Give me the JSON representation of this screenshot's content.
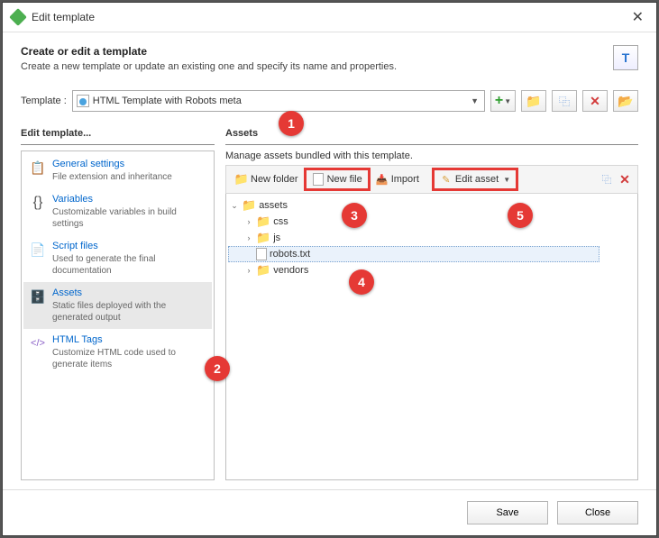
{
  "window": {
    "title": "Edit template"
  },
  "header": {
    "title": "Create or edit a template",
    "subtitle": "Create a new template or update an existing one and specify its name and properties.",
    "icon_letter": "T"
  },
  "template": {
    "label": "Template :",
    "value": "HTML Template with Robots meta"
  },
  "left_section": {
    "title": "Edit template..."
  },
  "nav": {
    "items": [
      {
        "title": "General settings",
        "sub": "File extension and inheritance"
      },
      {
        "title": "Variables",
        "sub": "Customizable variables in build settings"
      },
      {
        "title": "Script files",
        "sub": "Used to generate the final documentation"
      },
      {
        "title": "Assets",
        "sub": "Static files deployed with the generated output"
      },
      {
        "title": "HTML Tags",
        "sub": "Customize HTML code used to generate items"
      }
    ]
  },
  "right_section": {
    "title": "Assets",
    "subtitle": "Manage assets bundled with this template."
  },
  "toolbar": {
    "new_folder": "New folder",
    "new_file": "New file",
    "import": "Import",
    "edit_asset": "Edit asset"
  },
  "tree": {
    "root": "assets",
    "nodes": [
      "css",
      "js",
      "robots.txt",
      "vendors"
    ]
  },
  "footer": {
    "save": "Save",
    "close": "Close"
  },
  "callouts": [
    "1",
    "2",
    "3",
    "4",
    "5"
  ]
}
